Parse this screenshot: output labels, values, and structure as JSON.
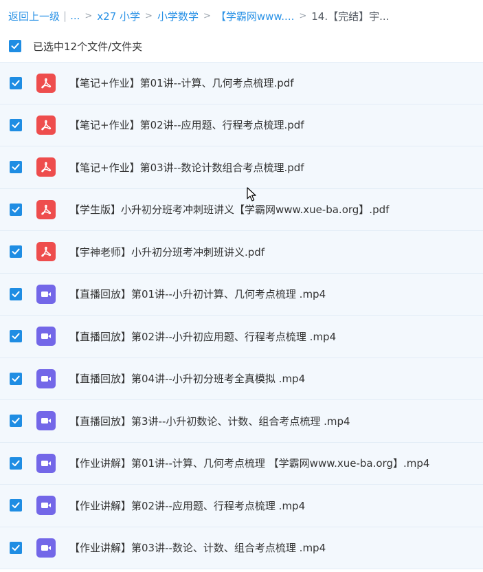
{
  "breadcrumb": {
    "back_label": "返回上一级",
    "pipe": "|",
    "ellipsis": "...",
    "separator": ">",
    "items": [
      "x27 小学",
      "小学数学",
      "【学霸网www....",
      "14.【完结】宇..."
    ]
  },
  "selection": {
    "text": "已选中12个文件/文件夹",
    "checked": true
  },
  "files": [
    {
      "name": "【笔记+作业】第01讲--计算、几何考点梳理.pdf",
      "type": "pdf",
      "icon": "pdf-icon",
      "checked": true
    },
    {
      "name": "【笔记+作业】第02讲--应用题、行程考点梳理.pdf",
      "type": "pdf",
      "icon": "pdf-icon",
      "checked": true
    },
    {
      "name": "【笔记+作业】第03讲--数论计数组合考点梳理.pdf",
      "type": "pdf",
      "icon": "pdf-icon",
      "checked": true
    },
    {
      "name": "【学生版】小升初分班考冲刺班讲义【学霸网www.xue-ba.org】.pdf",
      "type": "pdf",
      "icon": "pdf-icon",
      "checked": true
    },
    {
      "name": "【宇神老师】小升初分班考冲刺班讲义.pdf",
      "type": "pdf",
      "icon": "pdf-icon",
      "checked": true
    },
    {
      "name": "【直播回放】第01讲--小升初计算、几何考点梳理 .mp4",
      "type": "mp4",
      "icon": "video-icon",
      "checked": true
    },
    {
      "name": "【直播回放】第02讲--小升初应用题、行程考点梳理 .mp4",
      "type": "mp4",
      "icon": "video-icon",
      "checked": true
    },
    {
      "name": "【直播回放】第04讲--小升初分班考全真模拟 .mp4",
      "type": "mp4",
      "icon": "video-icon",
      "checked": true
    },
    {
      "name": "【直播回放】第3讲--小升初数论、计数、组合考点梳理 .mp4",
      "type": "mp4",
      "icon": "video-icon",
      "checked": true
    },
    {
      "name": "【作业讲解】第01讲--计算、几何考点梳理 【学霸网www.xue-ba.org】.mp4",
      "type": "mp4",
      "icon": "video-icon",
      "checked": true
    },
    {
      "name": "【作业讲解】第02讲--应用题、行程考点梳理 .mp4",
      "type": "mp4",
      "icon": "video-icon",
      "checked": true
    },
    {
      "name": "【作业讲解】第03讲--数论、计数、组合考点梳理 .mp4",
      "type": "mp4",
      "icon": "video-icon",
      "checked": true
    }
  ],
  "colors": {
    "link": "#2a92e6",
    "checkbox": "#1f8de3",
    "pdf_icon": "#ee4d4d",
    "video_icon": "#7367e8",
    "row_bg": "#f3f8fd",
    "row_border": "#e2ecf6"
  }
}
